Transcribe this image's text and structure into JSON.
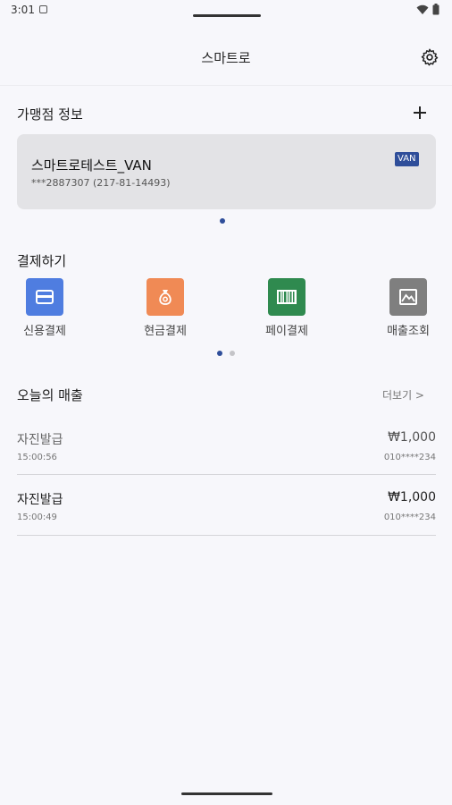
{
  "status": {
    "time": "3:01"
  },
  "app": {
    "title": "스마트로"
  },
  "merchant": {
    "section_title": "가맹점 정보",
    "name": "스마트로테스트_VAN",
    "sub": "***2887307 (217-81-14493)",
    "badge": "VAN"
  },
  "payment": {
    "section_title": "결제하기",
    "items": [
      {
        "label": "신용결제",
        "icon": "credit-card-icon",
        "color": "#4f7de0"
      },
      {
        "label": "현금결제",
        "icon": "money-bag-icon",
        "color": "#f08a55"
      },
      {
        "label": "페이결제",
        "icon": "barcode-icon",
        "color": "#2f8a4f"
      },
      {
        "label": "매출조회",
        "icon": "image-chart-icon",
        "color": "#7f7f7f"
      }
    ]
  },
  "sales": {
    "section_title": "오늘의 매출",
    "more": "더보기 >",
    "rows": [
      {
        "title": "자진발급",
        "time": "15:00:56",
        "amount": "₩1,000",
        "phone": "010****234"
      },
      {
        "title": "자진발급",
        "time": "15:00:49",
        "amount": "₩1,000",
        "phone": "010****234"
      }
    ]
  },
  "colors": {
    "accent": "#2f4e9a",
    "card_bg": "#e3e3e6",
    "background": "#f7f7fb"
  }
}
